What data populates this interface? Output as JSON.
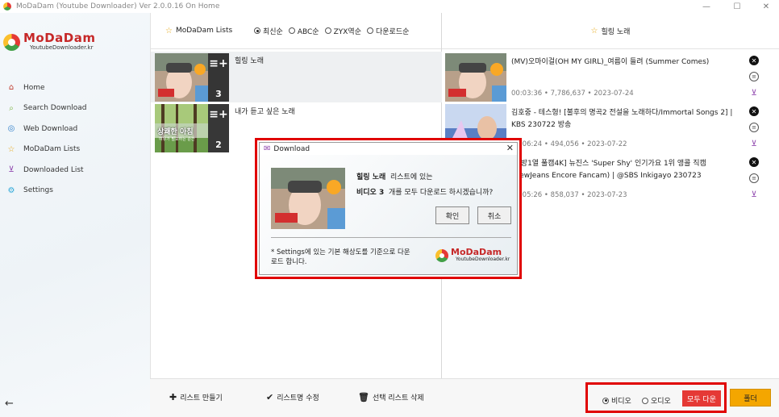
{
  "window": {
    "title": "MoDaDam (Youtube Downloader) Ver 2.0.0.16 On Home",
    "controls": {
      "minimize": "—",
      "maximize": "☐",
      "close": "✕"
    }
  },
  "brand": {
    "name": "MoDaDam",
    "tagline": "YoutubeDownloader.kr"
  },
  "sidebar": {
    "items": [
      {
        "label": "Home",
        "icon": "home-icon"
      },
      {
        "label": "Search Download",
        "icon": "search-icon"
      },
      {
        "label": "Web Download",
        "icon": "globe-icon"
      },
      {
        "label": "MoDaDam Lists",
        "icon": "star-icon"
      },
      {
        "label": "Downloaded List",
        "icon": "inbox-icon"
      },
      {
        "label": "Settings",
        "icon": "gear-icon"
      }
    ],
    "back_icon": "←"
  },
  "lists_panel": {
    "title": "MoDaDam Lists",
    "sort_options": [
      {
        "label": "최신순",
        "selected": true
      },
      {
        "label": "ABC순",
        "selected": false
      },
      {
        "label": "ZYX역순",
        "selected": false
      },
      {
        "label": "다운로드순",
        "selected": false
      }
    ],
    "lists": [
      {
        "name": "힐링 노래",
        "count": "3",
        "selected": true
      },
      {
        "name": "내가 듣고 싶은 노래",
        "count": "2",
        "selected": false
      }
    ],
    "thumb_text": {
      "forest_line1": "상쾌한 아침",
      "forest_line2": "여유가 필요하는 순간"
    }
  },
  "videos_panel": {
    "title": "힐링 노래",
    "videos": [
      {
        "title": "(MV)오마이걸(OH MY GIRL)_여름이 들려 (Summer Comes)",
        "meta": "00:03:36 • 7,786,637 • 2023-07-24"
      },
      {
        "title": "김호중 - 테스형! [불후의 명곡2 전설을 노래하다/Immortal Songs 2] | KBS 230722 방송",
        "meta": "00:06:24 • 494,056 • 2023-07-22"
      },
      {
        "title": "[안방1열 풀캠4K] 뉴진스 'Super Shy' 인기가요 1위 앵콜 직캠 (NewJeans Encore Fancam) | @SBS Inkigayo 230723",
        "meta": "00:05:26 • 858,037 • 2023-07-23"
      }
    ]
  },
  "bottom": {
    "create_list": "리스트 만들기",
    "rename_list": "리스트명 수정",
    "delete_list": "선택 리스트 삭제",
    "mode_video": "비디오",
    "mode_audio": "오디오",
    "mode_selected": "video",
    "download_all": "모두 다운",
    "folder": "폴더"
  },
  "dialog": {
    "title": "Download",
    "close": "✕",
    "list_name": "힐링 노래",
    "line1_suffix": "리스트에 있는",
    "line2_bold": "비디오 3",
    "line2_rest": "개를 모두 다운로드 하시겠습니까?",
    "confirm": "확인",
    "cancel": "취소",
    "note": "* Settings에 있는 기본 해상도를 기준으로 다운로드 합니다."
  },
  "colors": {
    "highlight_red": "#e00000",
    "download_all_bg": "#e53935",
    "folder_bg": "#f4a600",
    "accent_purple": "#8e44ad",
    "star_gold": "#e6a817"
  }
}
